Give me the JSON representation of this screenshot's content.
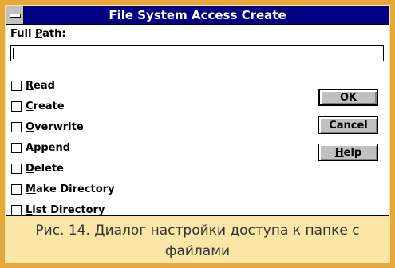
{
  "dialog": {
    "title": "File System Access Create",
    "full_path_label_pre": "Full ",
    "full_path_label_u": "P",
    "full_path_label_post": "ath:",
    "full_path_value": ""
  },
  "checkboxes": [
    {
      "u": "R",
      "rest": "ead",
      "checked": false
    },
    {
      "u": "C",
      "rest": "reate",
      "checked": false
    },
    {
      "u": "O",
      "rest": "verwrite",
      "checked": false
    },
    {
      "u": "A",
      "rest": "ppend",
      "checked": false
    },
    {
      "u": "D",
      "rest": "elete",
      "checked": false
    },
    {
      "u": "M",
      "rest": "ake Directory",
      "checked": false
    },
    {
      "u": "L",
      "rest": "ist Directory",
      "checked": false
    }
  ],
  "buttons": {
    "ok": "OK",
    "cancel": "Cancel",
    "help_u": "H",
    "help_rest": "elp"
  },
  "caption": "Рис. 14. Диалог настройки доступа к папке с файлами",
  "colors": {
    "title_bar": "#000080",
    "frame": "#e6a83a",
    "caption_bg": "#fbe6a8"
  }
}
